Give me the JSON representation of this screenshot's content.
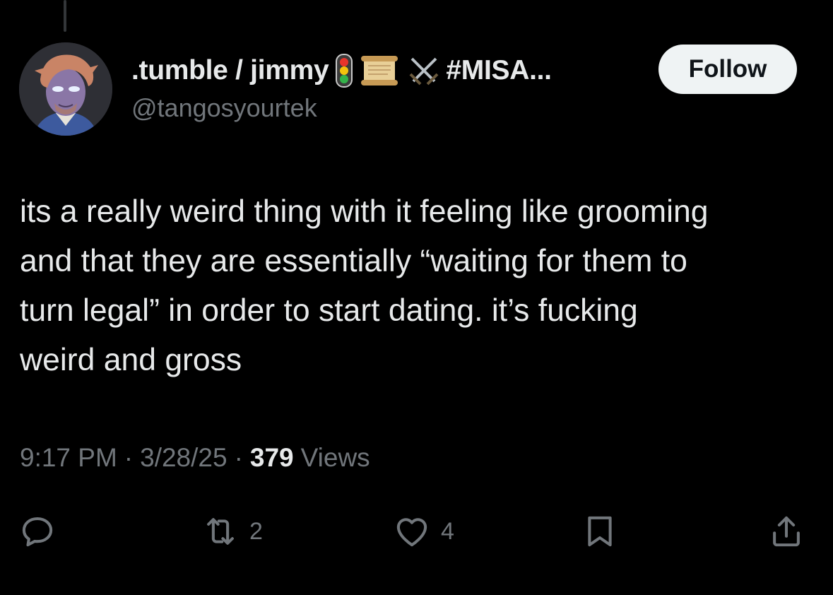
{
  "author": {
    "display_name": ".tumble / jimmy",
    "name_emojis": [
      "traffic-light-icon",
      "scroll-icon",
      "crossed-swords-icon"
    ],
    "name_suffix": "#MISA...",
    "handle": "@tangosyourtek"
  },
  "follow_label": "Follow",
  "tweet": {
    "text": "its a really weird thing with it feeling like grooming\nand that they are essentially “waiting for them to\nturn legal” in order to start dating. it’s fucking\nweird and gross"
  },
  "meta": {
    "time": "9:17 PM",
    "separator": "·",
    "date": "3/28/25",
    "views_count": "379",
    "views_label": "Views"
  },
  "actions": {
    "reply_icon": "reply-icon",
    "retweet_icon": "retweet-icon",
    "retweet_count": "2",
    "like_icon": "heart-icon",
    "like_count": "4",
    "bookmark_icon": "bookmark-icon",
    "share_icon": "share-icon"
  },
  "colors": {
    "background": "#000000",
    "primary_text": "#e7e9ea",
    "secondary_text": "#71767b",
    "button_bg": "#eff3f4",
    "button_text": "#0f1419"
  }
}
